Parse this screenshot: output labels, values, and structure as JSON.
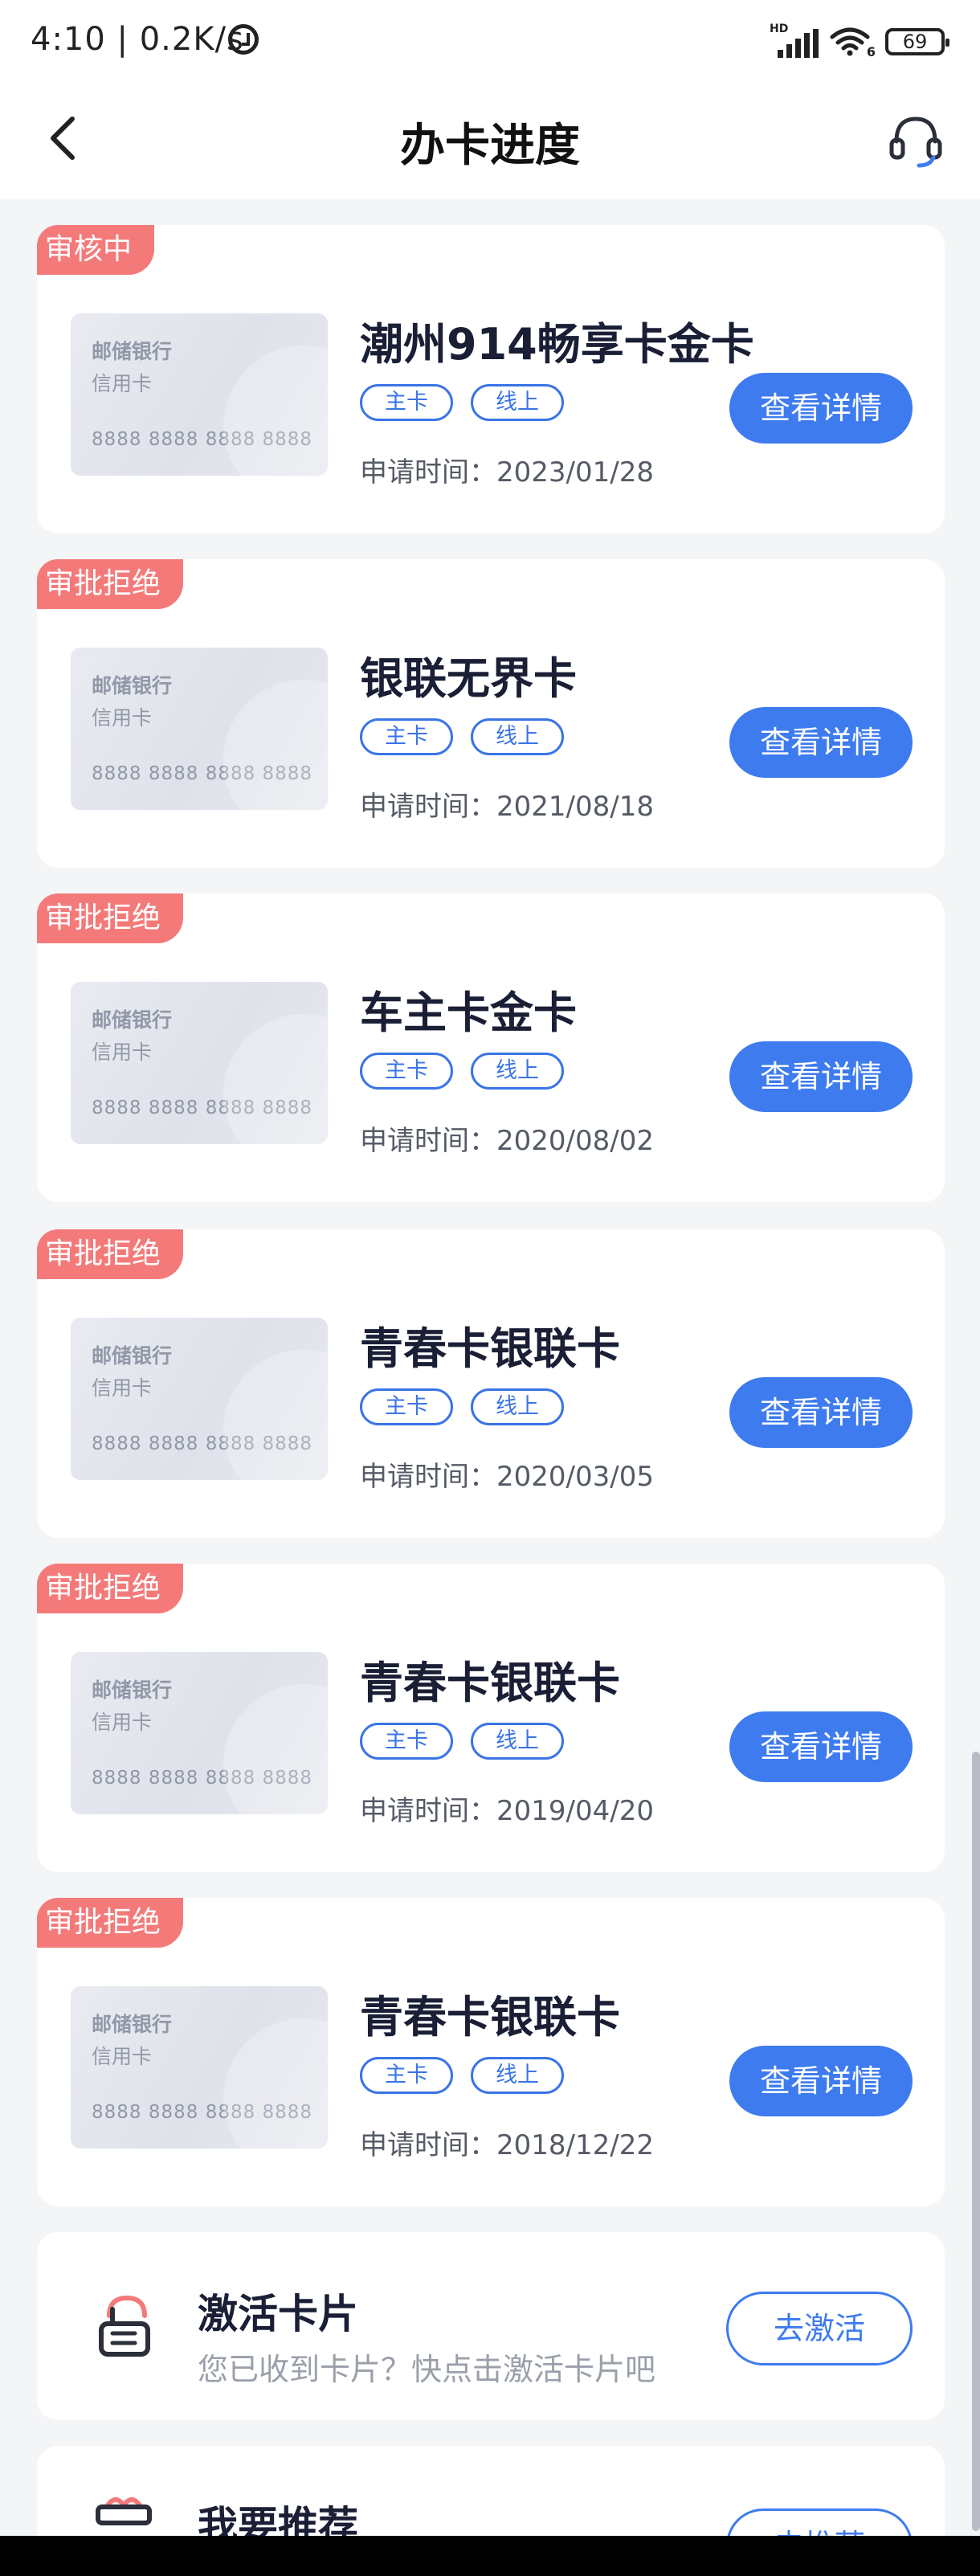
{
  "status_bar": {
    "time": "4:10 | 0.2K/s",
    "alarm_icon": "alarm-clock-icon",
    "hd_label": "HD",
    "wifi_label": "6",
    "battery": "69"
  },
  "header": {
    "title": "办卡进度",
    "back_icon": "chevron-left-icon",
    "service_icon": "headset-icon"
  },
  "colors": {
    "accent": "#3d7bef",
    "rejected_tag": "#f47a7a",
    "background": "#f4f5f7"
  },
  "applications": [
    {
      "status": "审核中",
      "bank": "邮储银行",
      "card_type": "信用卡",
      "card_number": "8888 8888 8888 8888",
      "name": "潮州914畅享卡金卡",
      "chip_primary": "主卡",
      "chip_channel": "线上",
      "apply_time": "申请时间：2023/01/28",
      "button": "查看详情"
    },
    {
      "status": "审批拒绝",
      "bank": "邮储银行",
      "card_type": "信用卡",
      "card_number": "8888 8888 8888 8888",
      "name": "银联无界卡",
      "chip_primary": "主卡",
      "chip_channel": "线上",
      "apply_time": "申请时间：2021/08/18",
      "button": "查看详情"
    },
    {
      "status": "审批拒绝",
      "bank": "邮储银行",
      "card_type": "信用卡",
      "card_number": "8888 8888 8888 8888",
      "name": "车主卡金卡",
      "chip_primary": "主卡",
      "chip_channel": "线上",
      "apply_time": "申请时间：2020/08/02",
      "button": "查看详情"
    },
    {
      "status": "审批拒绝",
      "bank": "邮储银行",
      "card_type": "信用卡",
      "card_number": "8888 8888 8888 8888",
      "name": "青春卡银联卡",
      "chip_primary": "主卡",
      "chip_channel": "线上",
      "apply_time": "申请时间：2020/03/05",
      "button": "查看详情"
    },
    {
      "status": "审批拒绝",
      "bank": "邮储银行",
      "card_type": "信用卡",
      "card_number": "8888 8888 8888 8888",
      "name": "青春卡银联卡",
      "chip_primary": "主卡",
      "chip_channel": "线上",
      "apply_time": "申请时间：2019/04/20",
      "button": "查看详情"
    },
    {
      "status": "审批拒绝",
      "bank": "邮储银行",
      "card_type": "信用卡",
      "card_number": "8888 8888 8888 8888",
      "name": "青春卡银联卡",
      "chip_primary": "主卡",
      "chip_channel": "线上",
      "apply_time": "申请时间：2018/12/22",
      "button": "查看详情"
    }
  ],
  "activate": {
    "icon": "hand-tap-card-icon",
    "title": "激活卡片",
    "subtitle": "您已收到卡片？快点击激活卡片吧",
    "button": "去激活"
  },
  "recommend": {
    "icon": "gift-icon",
    "title": "我要推荐",
    "button": "去推荐"
  }
}
